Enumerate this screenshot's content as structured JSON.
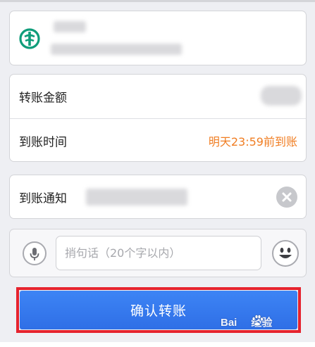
{
  "amount_row": {
    "label": "转账金额"
  },
  "time_row": {
    "label": "到账时间",
    "value": "明天23:59前到账"
  },
  "notify_row": {
    "label": "到账通知"
  },
  "memo": {
    "placeholder": "捎句话（20个字以内）"
  },
  "confirm": {
    "label": "确认转账"
  },
  "watermark": {
    "text": "Bai",
    "suffix": "经验"
  },
  "colors": {
    "accent_orange": "#f07d22",
    "button_blue": "#3479ee",
    "highlight_red": "#e5232e",
    "bank_green": "#0f9d7a"
  },
  "icons": [
    "bank-logo-icon",
    "clear-icon",
    "microphone-icon",
    "emoji-icon",
    "paw-icon"
  ]
}
